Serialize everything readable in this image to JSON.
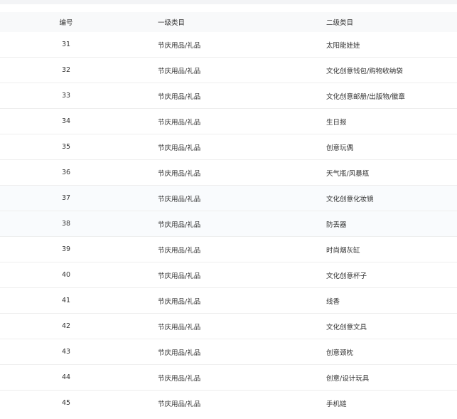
{
  "table": {
    "columns": [
      "编号",
      "一级类目",
      "二级类目"
    ],
    "rows": [
      {
        "id": "31",
        "cat1": "节庆用品/礼品",
        "cat2": "太阳能娃娃"
      },
      {
        "id": "32",
        "cat1": "节庆用品/礼品",
        "cat2": "文化创意钱包/购物收纳袋"
      },
      {
        "id": "33",
        "cat1": "节庆用品/礼品",
        "cat2": "文化创意邮册/出版物/徽章"
      },
      {
        "id": "34",
        "cat1": "节庆用品/礼品",
        "cat2": "生日报"
      },
      {
        "id": "35",
        "cat1": "节庆用品/礼品",
        "cat2": "创意玩偶"
      },
      {
        "id": "36",
        "cat1": "节庆用品/礼品",
        "cat2": "天气瓶/风暴瓶"
      },
      {
        "id": "37",
        "cat1": "节庆用品/礼品",
        "cat2": "文化创意化妆镜"
      },
      {
        "id": "38",
        "cat1": "节庆用品/礼品",
        "cat2": "防丢器"
      },
      {
        "id": "39",
        "cat1": "节庆用品/礼品",
        "cat2": "时尚烟灰缸"
      },
      {
        "id": "40",
        "cat1": "节庆用品/礼品",
        "cat2": "文化创意杯子"
      },
      {
        "id": "41",
        "cat1": "节庆用品/礼品",
        "cat2": "线香"
      },
      {
        "id": "42",
        "cat1": "节庆用品/礼品",
        "cat2": "文化创意文具"
      },
      {
        "id": "43",
        "cat1": "节庆用品/礼品",
        "cat2": "创意颈枕"
      },
      {
        "id": "44",
        "cat1": "节庆用品/礼品",
        "cat2": "创意/设计玩具"
      },
      {
        "id": "45",
        "cat1": "节庆用品/礼品",
        "cat2": "手机链"
      }
    ]
  }
}
